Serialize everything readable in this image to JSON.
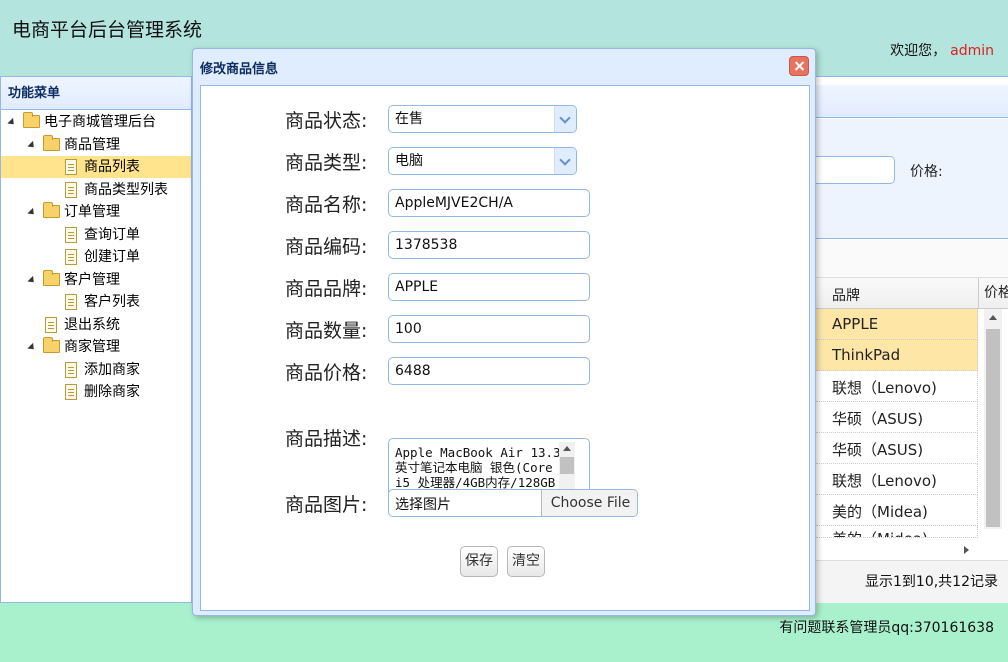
{
  "header": {
    "title": "电商平台后台管理系统",
    "welcome": "欢迎您，",
    "user": "admin"
  },
  "sidebar": {
    "title": "功能菜单",
    "tree": [
      {
        "label": "电子商城管理后台",
        "type": "folder"
      },
      {
        "label": "商品管理",
        "type": "folder"
      },
      {
        "label": "商品列表",
        "type": "file",
        "selected": true
      },
      {
        "label": "商品类型列表",
        "type": "file"
      },
      {
        "label": "订单管理",
        "type": "folder"
      },
      {
        "label": "查询订单",
        "type": "file"
      },
      {
        "label": "创建订单",
        "type": "file"
      },
      {
        "label": "客户管理",
        "type": "folder"
      },
      {
        "label": "客户列表",
        "type": "file"
      },
      {
        "label": "退出系统",
        "type": "file"
      },
      {
        "label": "商家管理",
        "type": "folder"
      },
      {
        "label": "添加商家",
        "type": "file"
      },
      {
        "label": "删除商家",
        "type": "file"
      }
    ]
  },
  "search": {
    "price_label": "价格:"
  },
  "grid": {
    "columns": [
      "品牌",
      "价格"
    ],
    "rows": [
      "APPLE",
      "ThinkPad",
      "联想（Lenovo)",
      "华硕（ASUS)",
      "华硕（ASUS)",
      "联想（Lenovo)",
      "美的（Midea)",
      "美的（Midea)"
    ],
    "pager": "显示1到10,共12记录"
  },
  "footer": {
    "text": "有问题联系管理员qq:370161638"
  },
  "dialog": {
    "title": "修改商品信息",
    "status_label": "商品状态:",
    "status_value": "在售",
    "type_label": "商品类型:",
    "type_value": "电脑",
    "name_label": "商品名称:",
    "name_value": "AppleMJVE2CH/A",
    "code_label": "商品编码:",
    "code_value": "1378538",
    "brand_label": "商品品牌:",
    "brand_value": "APPLE",
    "qty_label": "商品数量:",
    "qty_value": "100",
    "price_label": "商品价格:",
    "price_value": "6488",
    "desc_label": "商品描述:",
    "desc_value": "Apple MacBook Air 13.3英寸笔记本电脑 银色(Core i5 处理器/4GB内存/128GB",
    "image_label": "商品图片:",
    "image_placeholder": "选择图片",
    "choose_file": "Choose File",
    "save": "保存",
    "clear": "清空"
  }
}
